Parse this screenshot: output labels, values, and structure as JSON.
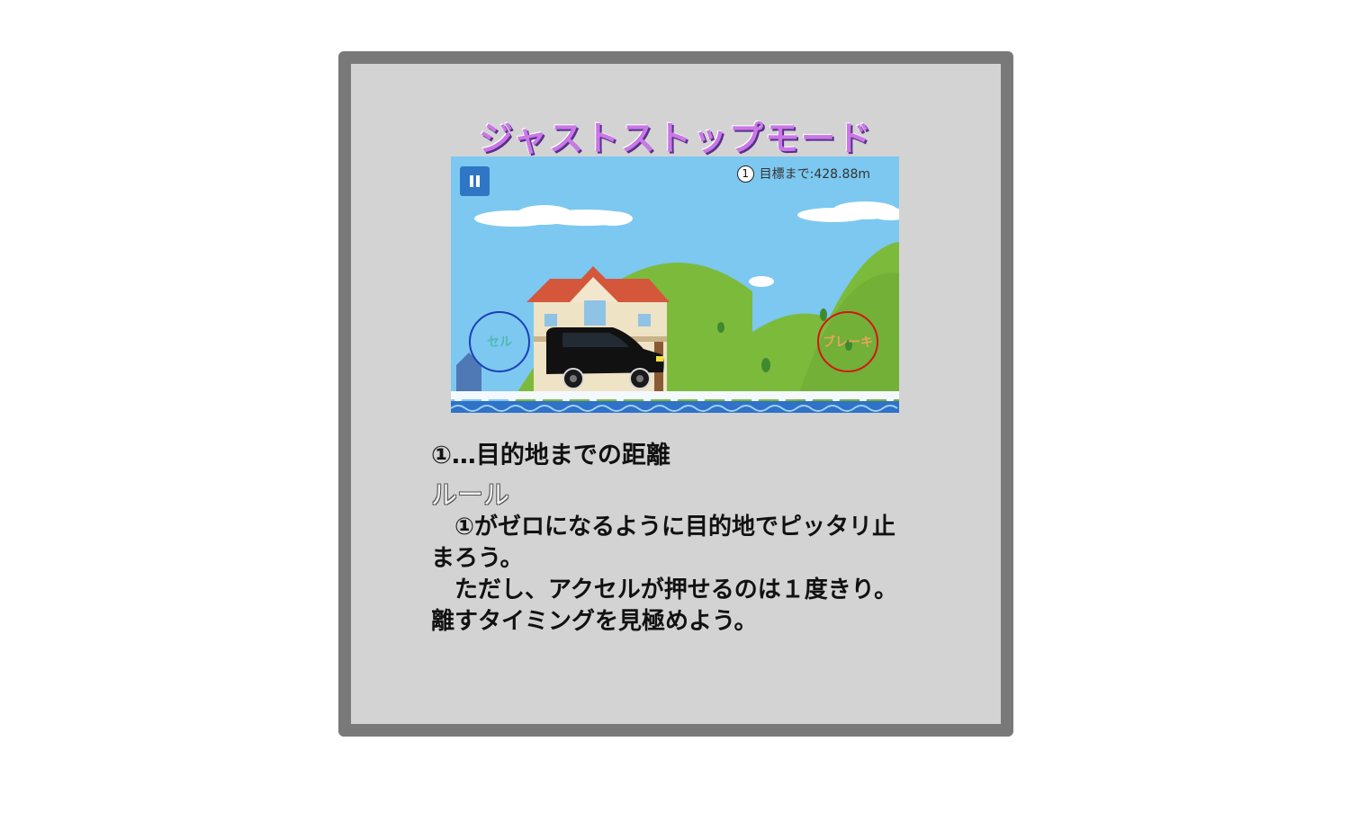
{
  "title": "ジャストストップモード",
  "hud": {
    "marker": "1",
    "distance": "目標まで:428.88m"
  },
  "controls": {
    "accel_label": "セル",
    "brake_label": "ブレーキ"
  },
  "legend": "①…目的地までの距離",
  "rule_heading": "ルール",
  "rule_p1": "　①がゼロになるように目的地でピッタリ止まろう。",
  "rule_p2": "　ただし、アクセルが押せるのは１度きり。離すタイミングを見極めよう。",
  "colors": {
    "frame": "#797979",
    "panel": "#d3d3d3",
    "sky": "#7cc8f0",
    "hill": "#7cba3c",
    "pause": "#2f77c4",
    "title": "#c978e6",
    "accel_ring": "#1d3fb8",
    "brake_ring": "#d41515",
    "water": "#2f72c8"
  }
}
